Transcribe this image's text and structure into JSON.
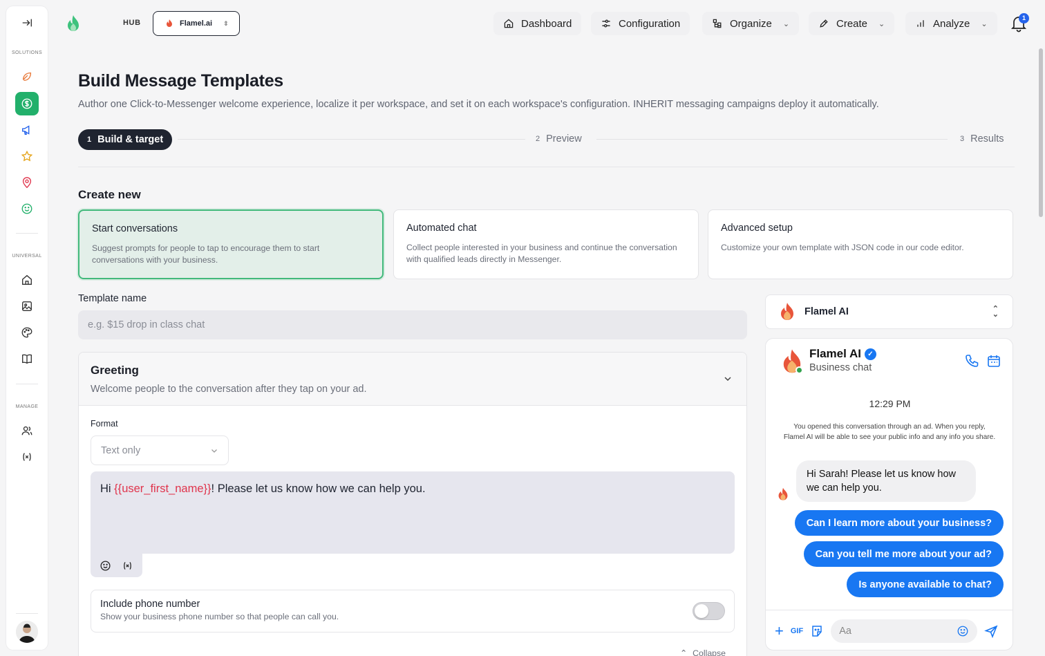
{
  "sidebar": {
    "sections": {
      "solutions": "SOLUTIONS",
      "universal": "UNIVERSAL",
      "manage": "MANAGE"
    },
    "items": [
      {
        "icon": "collapse-sidebar-icon"
      },
      {
        "icon": "leaf-icon",
        "color": "#e8793a"
      },
      {
        "icon": "dollar-icon",
        "active": true
      },
      {
        "icon": "megaphone-icon",
        "color": "#2563eb"
      },
      {
        "icon": "star-icon",
        "color": "#e5a317"
      },
      {
        "icon": "map-pin-icon",
        "color": "#e0344c"
      },
      {
        "icon": "smile-icon",
        "color": "#22b06b"
      },
      {
        "icon": "home-icon"
      },
      {
        "icon": "image-icon"
      },
      {
        "icon": "palette-icon"
      },
      {
        "icon": "book-icon"
      },
      {
        "icon": "users-icon"
      },
      {
        "icon": "variable-icon"
      }
    ]
  },
  "topnav": {
    "hub_label": "HUB",
    "workspace": "Flamel.ai",
    "items": {
      "dashboard": "Dashboard",
      "configuration": "Configuration",
      "organize": "Organize",
      "create": "Create",
      "analyze": "Analyze"
    },
    "notification_count": "1"
  },
  "page": {
    "title": "Build Message Templates",
    "subtitle": "Author one Click-to-Messenger welcome experience, localize it per workspace, and set it on each workspace's configuration. INHERIT messaging campaigns deploy it automatically."
  },
  "stepper": {
    "steps": [
      {
        "num": "1",
        "label": "Build & target",
        "active": true
      },
      {
        "num": "2",
        "label": "Preview"
      },
      {
        "num": "3",
        "label": "Results"
      }
    ]
  },
  "create_new": {
    "heading": "Create new",
    "options": [
      {
        "title": "Start conversations",
        "desc": "Suggest prompts for people to tap to encourage them to start conversations with your business.",
        "selected": true
      },
      {
        "title": "Automated chat",
        "desc": "Collect people interested in your business and continue the conversation with qualified leads directly in Messenger."
      },
      {
        "title": "Advanced setup",
        "desc": "Customize your own template with JSON code in our code editor."
      }
    ]
  },
  "template_name": {
    "label": "Template name",
    "placeholder": "e.g. $15 drop in class chat",
    "value": ""
  },
  "greeting": {
    "title": "Greeting",
    "desc": "Welcome people to the conversation after they tap on your ad.",
    "format_label": "Format",
    "format_value": "Text only",
    "message_prefix": "Hi ",
    "message_variable": "{{user_first_name}}",
    "message_suffix": "! Please let us know how we can help you.",
    "phone_title": "Include phone number",
    "phone_desc": "Show your business phone number so that people can call you.",
    "phone_enabled": false,
    "collapse_label": "Collapse"
  },
  "preview": {
    "account": "Flamel AI",
    "chat_name": "Flamel AI",
    "chat_sub": "Business chat",
    "time": "12:29 PM",
    "notice": "You opened this conversation through an ad. When you reply, Flamel AI will be able to see your public info and any info you share.",
    "greeting_bubble": "Hi Sarah! Please let us know how we can help you.",
    "replies": [
      "Can I learn more about your business?",
      "Can you tell me more about your ad?",
      "Is anyone available to chat?"
    ],
    "composer_gif": "GIF",
    "composer_placeholder": "Aa",
    "accent_color": "#1877f2"
  }
}
